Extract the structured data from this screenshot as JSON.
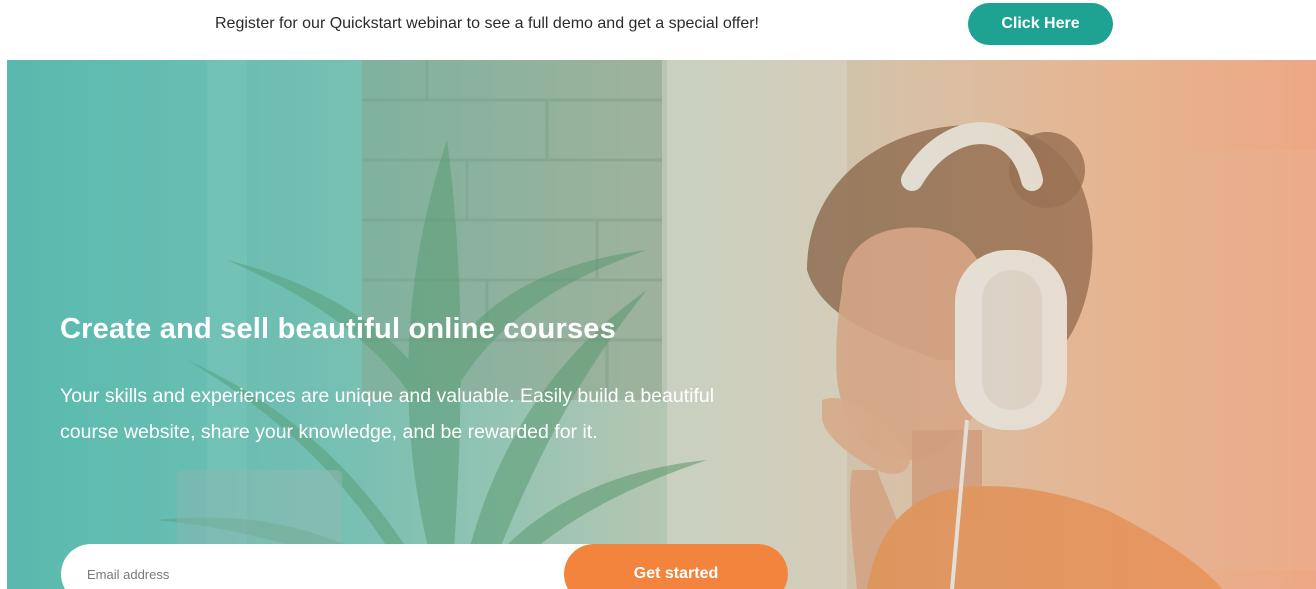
{
  "promo": {
    "text": "Register for our Quickstart webinar to see a full demo and get a special offer!",
    "button_label": "Click Here"
  },
  "hero": {
    "title": "Create and sell beautiful online courses",
    "subtitle": "Your skills and experiences are unique and valuable. Easily build a beautiful course website, share your knowledge, and be rewarded for it.",
    "email_placeholder": "Email address",
    "email_value": "",
    "cta_label": "Get started"
  },
  "colors": {
    "accent_teal": "#1ea393",
    "accent_orange": "#f2843e"
  }
}
